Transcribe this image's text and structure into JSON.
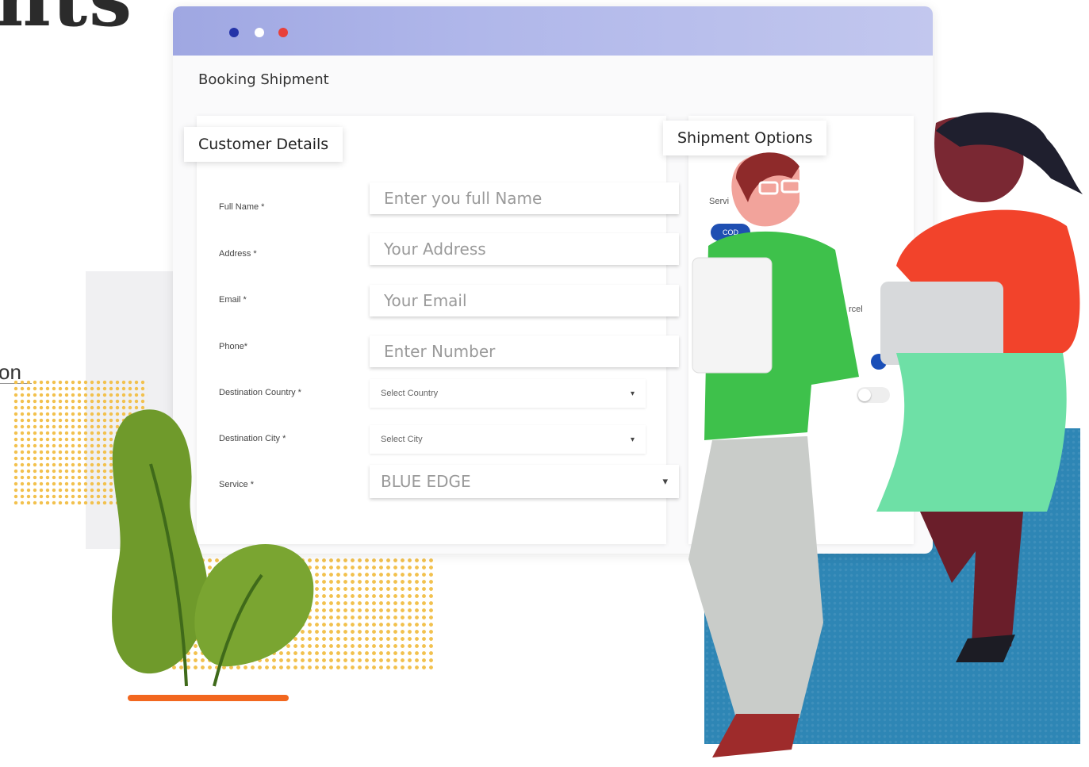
{
  "hero": {
    "title_fragment": "nts",
    "word_fragment": "on"
  },
  "window": {
    "page_title": "Booking Shipment",
    "customer_section": {
      "title": "Customer Details",
      "fields": [
        {
          "label": "Full Name *",
          "placeholder": "Enter you full Name"
        },
        {
          "label": "Address *",
          "placeholder": "Your Address"
        },
        {
          "label": "Email *",
          "placeholder": "Your Email"
        },
        {
          "label": "Phone*",
          "placeholder": "Enter Number"
        }
      ],
      "destination_country": {
        "label": "Destination Country *",
        "value": "Select Country"
      },
      "destination_city": {
        "label": "Destination City *",
        "value": "Select City"
      },
      "service": {
        "label": "Service *",
        "value": "BLUE EDGE"
      }
    },
    "shipment_section": {
      "title": "Shipment Options",
      "service_label_fragment": "Servi",
      "cod_label": "COD",
      "partial_label": "rcel"
    }
  },
  "colors": {
    "titlebar": "#a9b0e6",
    "accent_blue": "#2e86b5",
    "dot_red": "#e8403a",
    "dot_blue": "#2433a8",
    "plant_green": "#6f9a2b",
    "dots_yellow": "#f2c14e"
  },
  "icons": {
    "caret": "▾"
  }
}
